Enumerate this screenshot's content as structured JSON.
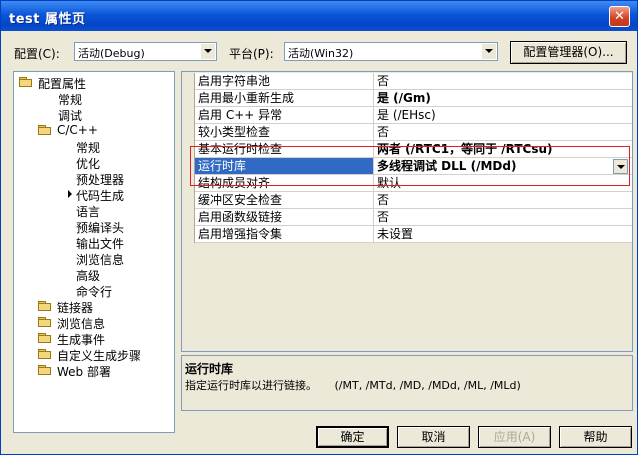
{
  "window": {
    "title": "test 属性页",
    "close_glyph": "✕"
  },
  "toolbar": {
    "config_label": "配置(C):",
    "config_value": "活动(Debug)",
    "platform_label": "平台(P):",
    "platform_value": "活动(Win32)",
    "config_manager_button": "配置管理器(O)..."
  },
  "tree": {
    "root": "配置属性",
    "items": [
      "常规",
      "调试"
    ],
    "cpp": "C/C++",
    "cpp_items": [
      "常规",
      "优化",
      "预处理器",
      "代码生成",
      "语言",
      "预编译头",
      "输出文件",
      "浏览信息",
      "高级",
      "命令行"
    ],
    "selected_item": "代码生成",
    "other_folders": [
      "链接器",
      "浏览信息",
      "生成事件",
      "自定义生成步骤",
      "Web 部署"
    ]
  },
  "properties": [
    {
      "name": "启用字符串池",
      "value": "否",
      "bold": false
    },
    {
      "name": "启用最小重新生成",
      "value": "是 (/Gm)",
      "bold": true
    },
    {
      "name": "启用 C++ 异常",
      "value": "是 (/EHsc)",
      "bold": false
    },
    {
      "name": "较小类型检查",
      "value": "否",
      "bold": false
    },
    {
      "name": "基本运行时检查",
      "value": "两者 (/RTC1，等同于 /RTCsu)",
      "bold": true
    },
    {
      "name": "运行时库",
      "value": "多线程调试 DLL (/MDd)",
      "bold": true,
      "selected": true
    },
    {
      "name": "结构成员对齐",
      "value": "默认",
      "bold": false
    },
    {
      "name": "缓冲区安全检查",
      "value": "否",
      "bold": false
    },
    {
      "name": "启用函数级链接",
      "value": "否",
      "bold": false
    },
    {
      "name": "启用增强指令集",
      "value": "未设置",
      "bold": false
    }
  ],
  "description": {
    "title": "运行时库",
    "text": "指定运行时库以进行链接。     (/MT, /MTd, /MD, /MDd, /ML, /MLd)"
  },
  "buttons": {
    "ok": "确定",
    "cancel": "取消",
    "apply": "应用(A)",
    "help": "帮助"
  },
  "colors": {
    "title_bar": "#0a56d8",
    "selection": "#316ac5",
    "highlight_box": "#e02020",
    "dialog_bg": "#ece9d8"
  },
  "icons": [
    "close-icon",
    "folder-icon",
    "dropdown-arrow-icon"
  ]
}
